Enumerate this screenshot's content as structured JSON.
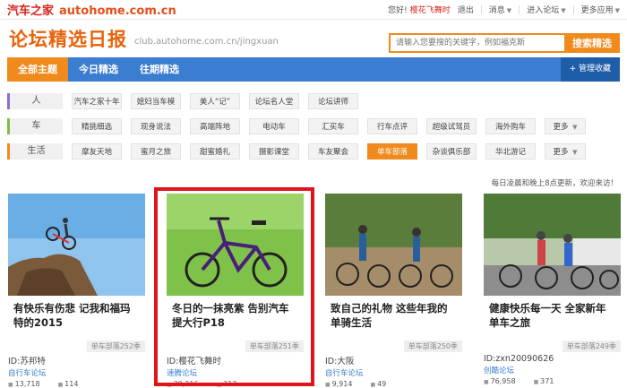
{
  "topbar": {
    "logo_cn": "汽车之家",
    "logo_en": "autohome.com.cn",
    "greeting": "您好!",
    "username": "樱花飞舞时",
    "logout": "退出",
    "messages": "消息",
    "enter_forum": "进入论坛",
    "more_apps": "更多应用"
  },
  "header": {
    "title": "论坛精选日报",
    "url": "club.autohome.com.cn/jingxuan",
    "search_placeholder": "请输入您要搜的关键字，例如福克斯",
    "search_button": "搜索精选"
  },
  "nav": {
    "tabs": [
      "全部主题",
      "今日精选",
      "往期精选"
    ],
    "collect": "+ 管理收藏"
  },
  "categories": [
    {
      "label": "人",
      "items": [
        "汽车之家十年",
        "媳妇当车模",
        "美人“记”",
        "论坛名人堂",
        "论坛讲师"
      ]
    },
    {
      "label": "车",
      "items": [
        "精挑细选",
        "现身说法",
        "高端阵地",
        "电动车",
        "汇买车",
        "行车点评",
        "超级试驾员",
        "海外购车",
        "更多"
      ]
    },
    {
      "label": "生活",
      "items": [
        "摩友天地",
        "蜜月之旅",
        "甜蜜婚礼",
        "摄影课堂",
        "车友聚会",
        "单车部落",
        "杂谈俱乐部",
        "华北游记",
        "更多"
      ]
    }
  ],
  "update_note": "每日凌晨和晚上8点更新，欢迎来访！",
  "cards": [
    {
      "title": "有快乐有伤悲 记我和福玛特的2015",
      "tag": "单车部落252季",
      "uid": "ID:苏邦特",
      "forum": "自行车论坛",
      "views": "13,718",
      "replies": "114"
    },
    {
      "title": "冬日的一抹亮紫 告别汽车提大行P18",
      "tag": "单车部落251季",
      "uid": "ID:樱花飞舞时",
      "forum": "速腾论坛",
      "views": "39,216",
      "replies": "212"
    },
    {
      "title": "致自己的礼物 这些年我的单骑生活",
      "tag": "单车部落250季",
      "uid": "ID:大阪",
      "forum": "自行车论坛",
      "views": "9,914",
      "replies": "49"
    },
    {
      "title": "健康快乐每一天 全家新年单车之旅",
      "tag": "单车部落249季",
      "uid": "ID:zxn20090626",
      "forum": "创酷论坛",
      "views": "76,958",
      "replies": "371"
    }
  ]
}
